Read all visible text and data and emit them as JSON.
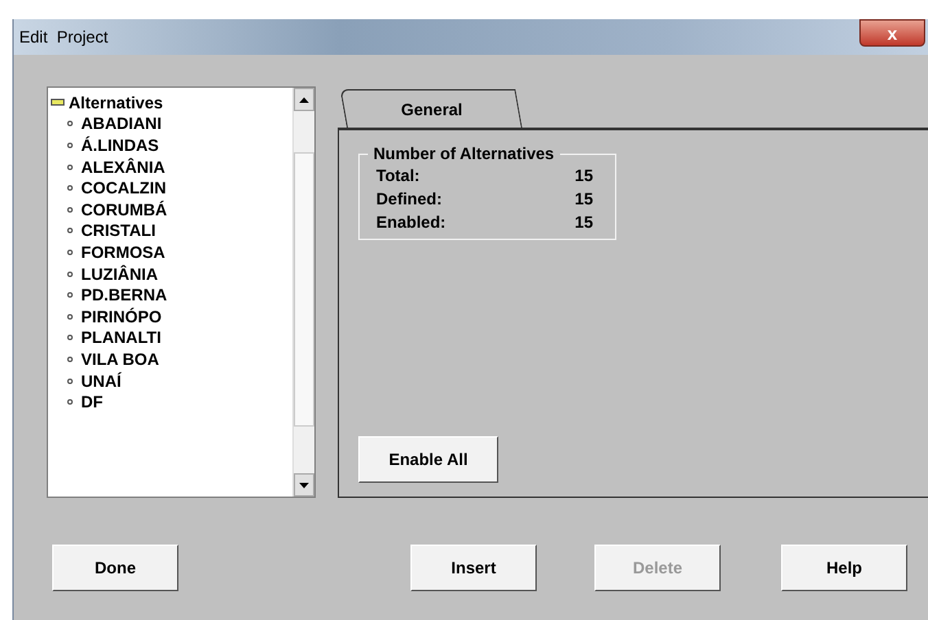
{
  "window": {
    "title": "Edit  Project",
    "close": "x"
  },
  "tree": {
    "label": "Alternatives",
    "expanded": true,
    "children": [
      {
        "label": "ABADIANI"
      },
      {
        "label": "Á.LINDAS"
      },
      {
        "label": "ALEXÂNIA"
      },
      {
        "label": "COCALZIN"
      },
      {
        "label": "CORUMBÁ"
      },
      {
        "label": "CRISTALI"
      },
      {
        "label": "FORMOSA"
      },
      {
        "label": "LUZIÂNIA"
      },
      {
        "label": "PD.BERNA"
      },
      {
        "label": "PIRINÓPO"
      },
      {
        "label": "PLANALTI"
      },
      {
        "label": "VILA BOA"
      },
      {
        "label": "UNAÍ"
      },
      {
        "label": "DF"
      }
    ]
  },
  "tabs": [
    {
      "label": "General",
      "selected": true
    }
  ],
  "group": {
    "title": "Number of Alternatives",
    "rows": [
      {
        "label": "Total:",
        "value": "15"
      },
      {
        "label": "Defined:",
        "value": "15"
      },
      {
        "label": "Enabled:",
        "value": "15"
      }
    ]
  },
  "enable_all": {
    "label": "Enable All",
    "disabled": false
  },
  "buttons": [
    {
      "label": "Done",
      "disabled": false
    },
    {
      "label": "Insert",
      "disabled": false
    },
    {
      "label": "Delete",
      "disabled": true
    },
    {
      "label": "Help",
      "disabled": false
    }
  ]
}
